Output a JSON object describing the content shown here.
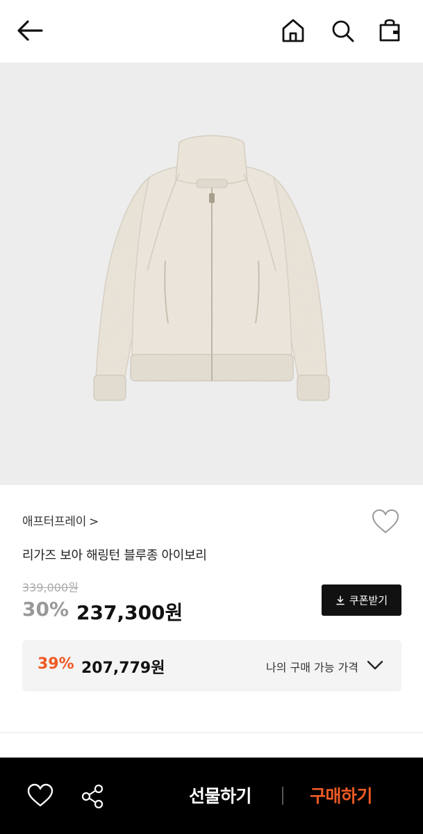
{
  "header": {
    "back_icon": "arrow-left-icon",
    "home_icon": "home-icon",
    "search_icon": "search-icon",
    "bag_icon": "shopping-bag-icon"
  },
  "product": {
    "image": "ivory-boa-fleece-harrington-jacket",
    "brand": "애프터프레이",
    "brand_chevron": ">",
    "name": "리가즈 보아 해링턴 블루종 아이보리",
    "original_price": "339,000원",
    "discount_rate": "30%",
    "sale_price": "237,300원",
    "coupon_label": "쿠폰받기"
  },
  "my_price": {
    "discount_rate": "39%",
    "price": "207,779원",
    "label": "나의 구매 가능 가격"
  },
  "bottom_bar": {
    "gift_label": "선물하기",
    "buy_label": "구매하기"
  },
  "colors": {
    "accent": "#ee5a24",
    "image_bg": "#ededed",
    "bottom_bar": "#000000"
  }
}
